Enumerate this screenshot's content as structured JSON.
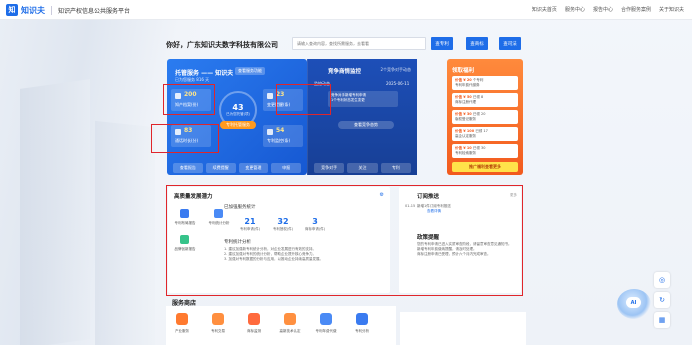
{
  "brand": {
    "logo_glyph": "知",
    "name": "知识夫",
    "site_name": "知识产权信息公共服务平台"
  },
  "topnav": [
    "知识夫首页",
    "服务中心",
    "报告中心",
    "合作服务案例",
    "关于知识夫"
  ],
  "header": {
    "company": "你好，广东知识夫数字科技有限公司",
    "search_placeholder": "请输入查询内容，查找所需服务，去看看",
    "btn_query": "查专利",
    "btn_brand": "查商标",
    "btn_apply": "查司法"
  },
  "service_panel": {
    "title": "托管服务 —— 知识夫",
    "badge": "查看服务功能",
    "subtitle": "已为您服务 816 天",
    "tiles": [
      {
        "num": "200",
        "label": "知产档案(份)"
      },
      {
        "num": "23",
        "label": "变更提醒(条)"
      },
      {
        "num": "83",
        "label": "通话时长(分)"
      },
      {
        "num": "54",
        "label": "专利监控(条)"
      }
    ],
    "center_num": "43",
    "center_label": "已为您托管(项)",
    "center_btn": "专利托管服务",
    "bottom_tabs": [
      "查看报告",
      "续费提醒",
      "变更管理",
      "申报"
    ]
  },
  "monitor_panel": {
    "title": "竞争商情监控",
    "right_label": "2个竞争对手动态",
    "row1_left": "监控动态",
    "row1_right": "2025-06-11",
    "card_line1": "竞争对手新增专利申请",
    "card_line2": "1个专利状态发生变更",
    "button": "查看竞争态势",
    "bottom_tabs": [
      "竞争对手",
      "关注",
      "专利"
    ]
  },
  "welfare_panel": {
    "title": "领取福利",
    "cards": [
      {
        "a": "价值 ¥ 20",
        "b": "个专利",
        "c": "专利年费代缴券"
      },
      {
        "a": "价值 ¥ 50",
        "b": "已领 8",
        "c": "商标注册代理"
      },
      {
        "a": "价值 ¥ 30",
        "b": "已领 20",
        "c": "版权登记服务"
      },
      {
        "a": "价值 ¥ 100",
        "b": "已领 17",
        "c": "高企认定服务"
      },
      {
        "a": "价值 ¥ 10",
        "b": "已领 30",
        "c": "专利检索服务"
      }
    ],
    "footer": "推广福利查看更多"
  },
  "dev_panel": {
    "title": "高质量发展潜力",
    "apps": [
      {
        "label": "专利布局报告",
        "color": "#3a7bf0"
      },
      {
        "label": "专利统计分析",
        "color": "#4a8af5"
      },
      {
        "label": "品牌创新报告",
        "color": "#36c38a"
      }
    ],
    "stats_title": "已加强服务统计",
    "stats": [
      {
        "v": "21",
        "l": "专利申请(件)"
      },
      {
        "v": "32",
        "l": "专利授权(件)"
      },
      {
        "v": "3",
        "l": "商标申请(件)"
      }
    ],
    "analysis_title": "专利统计分析",
    "analysis_lines": [
      "1. 建议加强新专利统计分析，对企业发展进行有效的支持。",
      "2. 建议加强对专利的统计分析，帮助企业提升核心竞争力。",
      "3. 加强对专利数据的分析与应用，以推动企业持续高质量发展。"
    ]
  },
  "notice_panel": {
    "title": "订阅推送",
    "more": "更多",
    "items": [
      {
        "date": "01-15",
        "text": "新增1件订阅专利推送",
        "link": "查看详情"
      }
    ],
    "section2_title": "政策提醒",
    "section2_lines": [
      "您的专利申请已进入实质审查阶段，请留意审查意见通知书。",
      "新增专利年费缴纳提醒，请及时处理。",
      "商标注册申请已受理，预计六个月内完成审查。"
    ]
  },
  "service_area": {
    "title": "服务商店",
    "items": [
      {
        "label": "产业服务",
        "color": "#ff7a2f"
      },
      {
        "label": "专利交易",
        "color": "#ff8f3f"
      },
      {
        "label": "商标监测",
        "color": "#ff6a3d"
      },
      {
        "label": "高新技术认定",
        "color": "#ff9040"
      },
      {
        "label": "专利年费代缴",
        "color": "#4a8af5"
      },
      {
        "label": "专利分析",
        "color": "#3a7bf0"
      }
    ]
  },
  "float": {
    "robot_label": "AI",
    "btn1": "◎",
    "btn2": "↻",
    "btn3": "▦"
  }
}
